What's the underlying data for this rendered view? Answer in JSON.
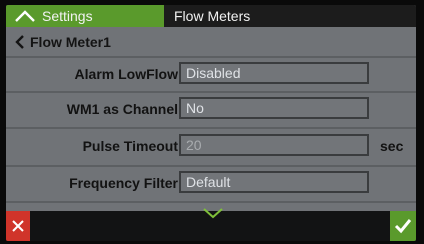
{
  "topbar": {
    "settings_tab_label": "Settings",
    "flow_tab_label": "Flow Meters"
  },
  "breadcrumb": {
    "label": "Flow Meter1"
  },
  "fields": [
    {
      "label": "Alarm LowFlow",
      "value": "Disabled"
    },
    {
      "label": "WM1 as Channel",
      "value": "No"
    },
    {
      "label": "Pulse Timeout",
      "value": "20",
      "unit": "sec"
    },
    {
      "label": "Frequency Filter",
      "value": "Default"
    }
  ],
  "icons": {
    "settings_tab": "chevron-up-icon",
    "back": "chevron-left-icon",
    "scroll": "chevron-down-icon",
    "cancel": "close-icon",
    "confirm": "check-icon"
  },
  "colors": {
    "accent_green": "#5a9a2c",
    "cancel_red": "#d0342a",
    "screen_gray": "#707377"
  }
}
